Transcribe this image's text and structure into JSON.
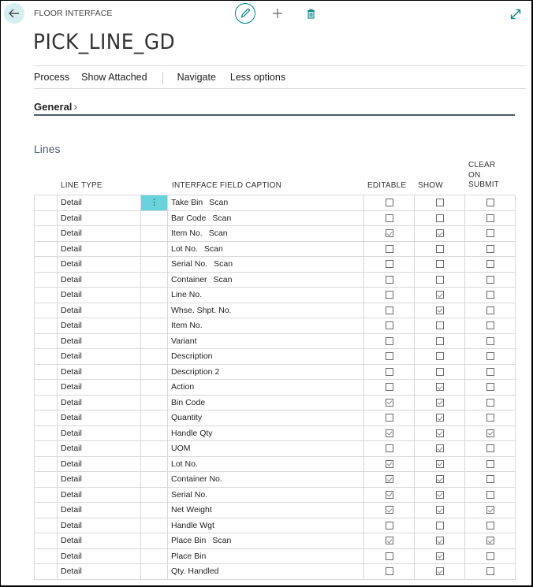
{
  "header": {
    "breadcrumb": "FLOOR INTERFACE",
    "title": "PICK_LINE_GD",
    "icons": {
      "back": "arrow-left-icon",
      "edit": "pencil-icon",
      "add": "plus-icon",
      "delete": "trash-icon",
      "expand": "expand-arrows-icon"
    }
  },
  "actions": {
    "process": "Process",
    "show_attached": "Show Attached",
    "navigate": "Navigate",
    "less_options": "Less options"
  },
  "general": {
    "label": "General",
    "chevron": "›"
  },
  "lines": {
    "title": "Lines",
    "columns": {
      "line_type": "LINE TYPE",
      "caption": "INTERFACE FIELD CAPTION",
      "editable": "EDITABLE",
      "show": "SHOW",
      "clear_line1": "CLEAR",
      "clear_line2": "ON",
      "clear_line3": "SUBMIT"
    },
    "menu_glyph": "⋮",
    "rows": [
      {
        "type": "Detail",
        "caption": "Take Bin",
        "suffix": "Scan",
        "editable": false,
        "show": false,
        "clear": false
      },
      {
        "type": "Detail",
        "caption": "Bar Code",
        "suffix": "Scan",
        "editable": false,
        "show": false,
        "clear": false
      },
      {
        "type": "Detail",
        "caption": "Item No.",
        "suffix": "Scan",
        "editable": true,
        "show": true,
        "clear": false
      },
      {
        "type": "Detail",
        "caption": "Lot No.",
        "suffix": "Scan",
        "editable": false,
        "show": false,
        "clear": false
      },
      {
        "type": "Detail",
        "caption": "Serial No.",
        "suffix": "Scan",
        "editable": false,
        "show": false,
        "clear": false
      },
      {
        "type": "Detail",
        "caption": "Container",
        "suffix": "Scan",
        "editable": false,
        "show": false,
        "clear": false
      },
      {
        "type": "Detail",
        "caption": "Line No.",
        "suffix": "",
        "editable": false,
        "show": true,
        "clear": false
      },
      {
        "type": "Detail",
        "caption": "Whse. Shpt. No.",
        "suffix": "",
        "editable": false,
        "show": true,
        "clear": false
      },
      {
        "type": "Detail",
        "caption": "Item No.",
        "suffix": "",
        "editable": false,
        "show": false,
        "clear": false
      },
      {
        "type": "Detail",
        "caption": "Variant",
        "suffix": "",
        "editable": false,
        "show": false,
        "clear": false
      },
      {
        "type": "Detail",
        "caption": "Description",
        "suffix": "",
        "editable": false,
        "show": false,
        "clear": false
      },
      {
        "type": "Detail",
        "caption": "Description 2",
        "suffix": "",
        "editable": false,
        "show": false,
        "clear": false
      },
      {
        "type": "Detail",
        "caption": "Action",
        "suffix": "",
        "editable": false,
        "show": true,
        "clear": false
      },
      {
        "type": "Detail",
        "caption": "Bin Code",
        "suffix": "",
        "editable": true,
        "show": true,
        "clear": false
      },
      {
        "type": "Detail",
        "caption": "Quantity",
        "suffix": "",
        "editable": false,
        "show": true,
        "clear": false
      },
      {
        "type": "Detail",
        "caption": "Handle Qty",
        "suffix": "",
        "editable": true,
        "show": true,
        "clear": true
      },
      {
        "type": "Detail",
        "caption": "UOM",
        "suffix": "",
        "editable": false,
        "show": true,
        "clear": false
      },
      {
        "type": "Detail",
        "caption": "Lot No.",
        "suffix": "",
        "editable": true,
        "show": true,
        "clear": false
      },
      {
        "type": "Detail",
        "caption": "Container No.",
        "suffix": "",
        "editable": true,
        "show": true,
        "clear": false
      },
      {
        "type": "Detail",
        "caption": "Serial No.",
        "suffix": "",
        "editable": true,
        "show": true,
        "clear": false
      },
      {
        "type": "Detail",
        "caption": "Net Weight",
        "suffix": "",
        "editable": true,
        "show": true,
        "clear": true
      },
      {
        "type": "Detail",
        "caption": "Handle Wgt",
        "suffix": "",
        "editable": false,
        "show": false,
        "clear": false
      },
      {
        "type": "Detail",
        "caption": "Place Bin",
        "suffix": "Scan",
        "editable": true,
        "show": true,
        "clear": true
      },
      {
        "type": "Detail",
        "caption": "Place Bin",
        "suffix": "",
        "editable": false,
        "show": true,
        "clear": false
      },
      {
        "type": "Detail",
        "caption": "Qty. Handled",
        "suffix": "",
        "editable": false,
        "show": true,
        "clear": false
      }
    ]
  },
  "colors": {
    "accent": "#008489",
    "active_cell": "#68d3dc",
    "back_button_bg": "#d6eef0",
    "section_bar": "#505c6d"
  }
}
